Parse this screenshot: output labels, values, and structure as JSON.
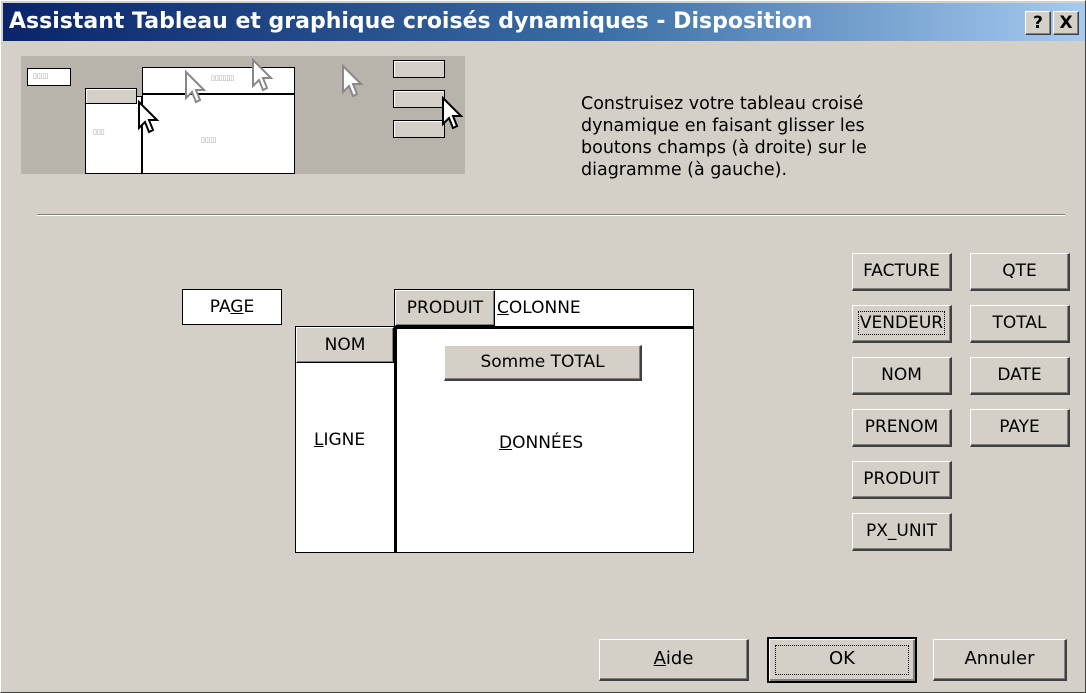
{
  "window": {
    "title": "Assistant Tableau et graphique croisés dynamiques - Disposition",
    "help_button": "?",
    "close_button": "X"
  },
  "instructions": "Construisez votre tableau croisé dynamique en faisant glisser les boutons champs (à droite) sur le diagramme (à gauche).",
  "layout": {
    "page_zone": {
      "label": "PAGE",
      "accel": "G"
    },
    "column_zone": {
      "label": "COLONNE",
      "accel": "C"
    },
    "row_zone": {
      "label": "LIGNE",
      "accel": "L"
    },
    "data_zone": {
      "label": "DONNÉES",
      "accel": "D"
    },
    "column_field": "PRODUIT",
    "row_field": "NOM",
    "data_field": "Somme TOTAL"
  },
  "fields": {
    "left": [
      "FACTURE",
      "VENDEUR",
      "NOM",
      "PRENOM",
      "PRODUIT",
      "PX_UNIT"
    ],
    "right": [
      "QTE",
      "TOTAL",
      "DATE",
      "PAYE"
    ],
    "focused": "VENDEUR"
  },
  "buttons": {
    "help": {
      "label": "Aide",
      "accel": "A"
    },
    "ok": {
      "label": "OK"
    },
    "cancel": {
      "label": "Annuler"
    }
  }
}
